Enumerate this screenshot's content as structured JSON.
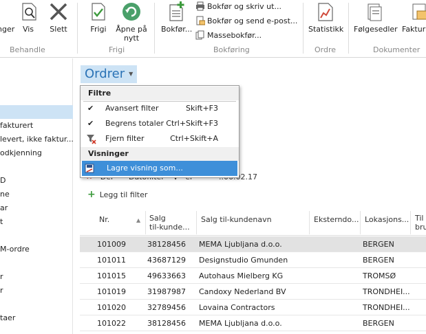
{
  "ribbon": {
    "groups": {
      "behandle": "Behandle",
      "frigi": "Frigi",
      "bokforing": "Bokføring",
      "ordre": "Ordre",
      "dokumenter": "Dokumenter"
    },
    "buttons": {
      "ny_partial": "nger",
      "vis": "Vis",
      "slett": "Slett",
      "frigi": "Frigi",
      "apne_line1": "Åpne på",
      "apne_line2": "nytt",
      "bokfor": "Bokfør...",
      "bokfor_skriv": "Bokfør og skriv ut...",
      "bokfor_send": "Bokfør og send e-post...",
      "massebokfor": "Massebokfør...",
      "statistikk": "Statistikk",
      "folgesedler": "Følgesedler",
      "fakturaer": "Fakturaer"
    }
  },
  "leftnav": {
    "items": [
      "",
      "fakturert",
      "levert, ikke faktur...",
      "odkjenning",
      "D",
      "ne",
      "ar",
      "t",
      "M-ordre",
      "r",
      "r",
      "taer"
    ]
  },
  "page": {
    "title": "Ordrer"
  },
  "menu": {
    "filtre_header": "Filtre",
    "avansert": "Avansert filter",
    "avansert_shortcut": "Skift+F3",
    "begrens": "Begrens totaler",
    "begrens_shortcut": "Ctrl+Skift+F3",
    "fjern": "Fjern filter",
    "fjern_shortcut": "Ctrl+Skift+A",
    "visninger_header": "Visninger",
    "lagre": "Lagre visning som..."
  },
  "filter": {
    "partial_field": "Der",
    "partial_type": "Datofilter",
    "partial_op": "er",
    "partial_value": "..06.02.17",
    "add_filter": "Legg til filter"
  },
  "table": {
    "headers": {
      "nr": "Nr.",
      "salg_kunde_line1": "Salg",
      "salg_kunde_line2": "til-kunde...",
      "salg_navn": "Salg til-kundenavn",
      "ekstern": "Eksterndo...",
      "lokasjon": "Lokasjons...",
      "tilb_line1": "Til",
      "tilb_line2": "bru"
    },
    "rows": [
      {
        "nr": "101009",
        "kunde": "38128456",
        "navn": "MEMA Ljubljana d.o.o.",
        "ekstern": "",
        "lokasjon": "BERGEN"
      },
      {
        "nr": "101011",
        "kunde": "43687129",
        "navn": "Designstudio Gmunden",
        "ekstern": "",
        "lokasjon": "BERGEN"
      },
      {
        "nr": "101015",
        "kunde": "49633663",
        "navn": "Autohaus Mielberg KG",
        "ekstern": "",
        "lokasjon": "TROMSØ"
      },
      {
        "nr": "101019",
        "kunde": "31987987",
        "navn": "Candoxy Nederland BV",
        "ekstern": "",
        "lokasjon": "TRONDHEI..."
      },
      {
        "nr": "101020",
        "kunde": "32789456",
        "navn": "Lovaina Contractors",
        "ekstern": "",
        "lokasjon": "TRONDHEI..."
      },
      {
        "nr": "101022",
        "kunde": "38128456",
        "navn": "MEMA Ljubljana d.o.o.",
        "ekstern": "",
        "lokasjon": "BERGEN"
      }
    ]
  },
  "colors": {
    "accent": "#2b73b6",
    "selection": "#cde3f5",
    "menu_highlight": "#3e8fd9"
  }
}
